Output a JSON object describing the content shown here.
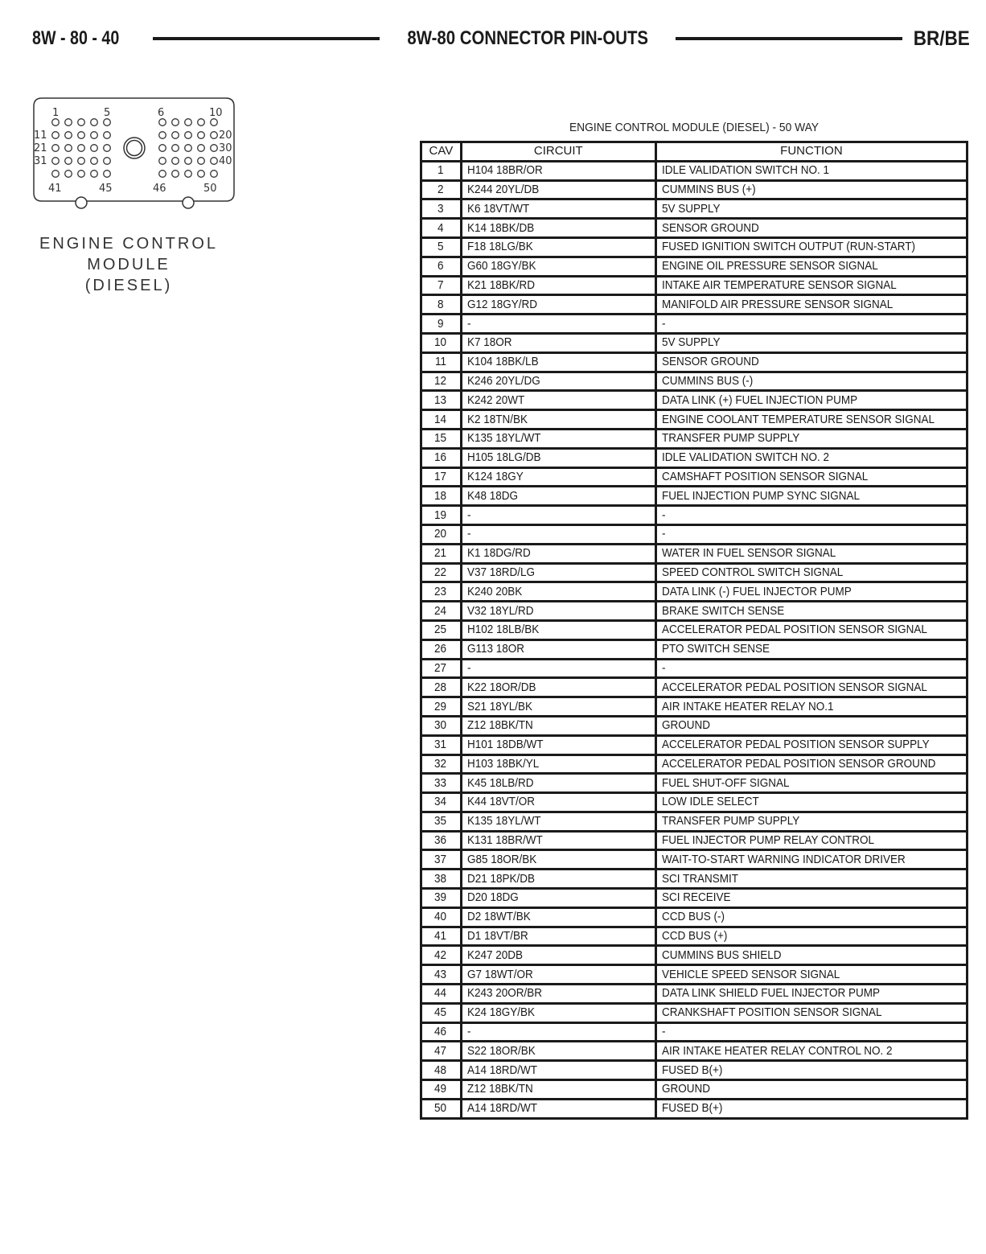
{
  "header": {
    "page_code": "8W - 80 - 40",
    "section_title": "8W-80 CONNECTOR PIN-OUTS",
    "model": "BR/BE"
  },
  "connector": {
    "caption_lines": [
      "ENGINE CONTROL",
      "MODULE",
      "(DIESEL)"
    ],
    "pin_labels": {
      "top_left_start": "1",
      "top_left_end": "5",
      "top_right_start": "6",
      "top_right_end": "10",
      "row2_left": "11",
      "row2_right": "20",
      "row3_left": "21",
      "row3_right": "30",
      "row4_left": "31",
      "row4_right": "40",
      "bottom_left_start": "41",
      "bottom_left_end": "45",
      "bottom_right_start": "46",
      "bottom_right_end": "50"
    }
  },
  "table": {
    "title": "ENGINE CONTROL MODULE (DIESEL) - 50 WAY",
    "headers": {
      "cav": "CAV",
      "circuit": "CIRCUIT",
      "function": "FUNCTION"
    },
    "rows": [
      {
        "cav": "1",
        "circuit": "H104 18BR/OR",
        "function": "IDLE VALIDATION SWITCH NO. 1"
      },
      {
        "cav": "2",
        "circuit": "K244 20YL/DB",
        "function": "CUMMINS BUS (+)"
      },
      {
        "cav": "3",
        "circuit": "K6 18VT/WT",
        "function": "5V SUPPLY"
      },
      {
        "cav": "4",
        "circuit": "K14 18BK/DB",
        "function": "SENSOR GROUND"
      },
      {
        "cav": "5",
        "circuit": "F18 18LG/BK",
        "function": "FUSED IGNITION SWITCH OUTPUT (RUN-START)"
      },
      {
        "cav": "6",
        "circuit": "G60 18GY/BK",
        "function": "ENGINE OIL PRESSURE SENSOR SIGNAL"
      },
      {
        "cav": "7",
        "circuit": "K21 18BK/RD",
        "function": "INTAKE AIR TEMPERATURE SENSOR SIGNAL"
      },
      {
        "cav": "8",
        "circuit": "G12 18GY/RD",
        "function": "MANIFOLD AIR PRESSURE SENSOR SIGNAL"
      },
      {
        "cav": "9",
        "circuit": "-",
        "function": "-"
      },
      {
        "cav": "10",
        "circuit": "K7 18OR",
        "function": "5V SUPPLY"
      },
      {
        "cav": "11",
        "circuit": "K104 18BK/LB",
        "function": "SENSOR GROUND"
      },
      {
        "cav": "12",
        "circuit": "K246 20YL/DG",
        "function": "CUMMINS BUS (-)"
      },
      {
        "cav": "13",
        "circuit": "K242 20WT",
        "function": "DATA LINK (+) FUEL INJECTION PUMP"
      },
      {
        "cav": "14",
        "circuit": "K2 18TN/BK",
        "function": "ENGINE COOLANT TEMPERATURE SENSOR SIGNAL"
      },
      {
        "cav": "15",
        "circuit": "K135 18YL/WT",
        "function": "TRANSFER PUMP SUPPLY"
      },
      {
        "cav": "16",
        "circuit": "H105 18LG/DB",
        "function": "IDLE VALIDATION SWITCH NO. 2"
      },
      {
        "cav": "17",
        "circuit": "K124 18GY",
        "function": "CAMSHAFT POSITION SENSOR SIGNAL"
      },
      {
        "cav": "18",
        "circuit": "K48 18DG",
        "function": "FUEL INJECTION PUMP SYNC SIGNAL"
      },
      {
        "cav": "19",
        "circuit": "-",
        "function": "-"
      },
      {
        "cav": "20",
        "circuit": "-",
        "function": "-"
      },
      {
        "cav": "21",
        "circuit": "K1 18DG/RD",
        "function": "WATER IN FUEL SENSOR SIGNAL"
      },
      {
        "cav": "22",
        "circuit": "V37 18RD/LG",
        "function": "SPEED CONTROL SWITCH SIGNAL"
      },
      {
        "cav": "23",
        "circuit": "K240 20BK",
        "function": "DATA LINK (-) FUEL INJECTOR PUMP"
      },
      {
        "cav": "24",
        "circuit": "V32 18YL/RD",
        "function": "BRAKE SWITCH SENSE"
      },
      {
        "cav": "25",
        "circuit": "H102 18LB/BK",
        "function": "ACCELERATOR PEDAL POSITION SENSOR SIGNAL"
      },
      {
        "cav": "26",
        "circuit": "G113 18OR",
        "function": "PTO SWITCH SENSE"
      },
      {
        "cav": "27",
        "circuit": "-",
        "function": "-"
      },
      {
        "cav": "28",
        "circuit": "K22 18OR/DB",
        "function": "ACCELERATOR PEDAL POSITION SENSOR SIGNAL"
      },
      {
        "cav": "29",
        "circuit": "S21 18YL/BK",
        "function": "AIR INTAKE HEATER RELAY NO.1"
      },
      {
        "cav": "30",
        "circuit": "Z12 18BK/TN",
        "function": "GROUND"
      },
      {
        "cav": "31",
        "circuit": "H101 18DB/WT",
        "function": "ACCELERATOR PEDAL POSITION SENSOR SUPPLY"
      },
      {
        "cav": "32",
        "circuit": "H103 18BK/YL",
        "function": "ACCELERATOR PEDAL POSITION SENSOR GROUND"
      },
      {
        "cav": "33",
        "circuit": "K45 18LB/RD",
        "function": "FUEL SHUT-OFF SIGNAL"
      },
      {
        "cav": "34",
        "circuit": "K44 18VT/OR",
        "function": "LOW IDLE SELECT"
      },
      {
        "cav": "35",
        "circuit": "K135 18YL/WT",
        "function": "TRANSFER PUMP SUPPLY"
      },
      {
        "cav": "36",
        "circuit": "K131 18BR/WT",
        "function": "FUEL INJECTOR PUMP RELAY CONTROL"
      },
      {
        "cav": "37",
        "circuit": "G85 18OR/BK",
        "function": "WAIT-TO-START WARNING INDICATOR DRIVER"
      },
      {
        "cav": "38",
        "circuit": "D21 18PK/DB",
        "function": "SCI TRANSMIT"
      },
      {
        "cav": "39",
        "circuit": "D20 18DG",
        "function": "SCI RECEIVE"
      },
      {
        "cav": "40",
        "circuit": "D2 18WT/BK",
        "function": "CCD BUS (-)"
      },
      {
        "cav": "41",
        "circuit": "D1 18VT/BR",
        "function": "CCD BUS (+)"
      },
      {
        "cav": "42",
        "circuit": "K247 20DB",
        "function": "CUMMINS BUS SHIELD"
      },
      {
        "cav": "43",
        "circuit": "G7 18WT/OR",
        "function": "VEHICLE SPEED SENSOR SIGNAL"
      },
      {
        "cav": "44",
        "circuit": "K243 20OR/BR",
        "function": "DATA LINK SHIELD FUEL INJECTOR PUMP"
      },
      {
        "cav": "45",
        "circuit": "K24 18GY/BK",
        "function": "CRANKSHAFT POSITION SENSOR SIGNAL"
      },
      {
        "cav": "46",
        "circuit": "-",
        "function": "-"
      },
      {
        "cav": "47",
        "circuit": "S22 18OR/BK",
        "function": "AIR INTAKE HEATER RELAY CONTROL NO. 2"
      },
      {
        "cav": "48",
        "circuit": "A14 18RD/WT",
        "function": "FUSED B(+)"
      },
      {
        "cav": "49",
        "circuit": "Z12 18BK/TN",
        "function": "GROUND"
      },
      {
        "cav": "50",
        "circuit": "A14 18RD/WT",
        "function": "FUSED B(+)"
      }
    ]
  }
}
